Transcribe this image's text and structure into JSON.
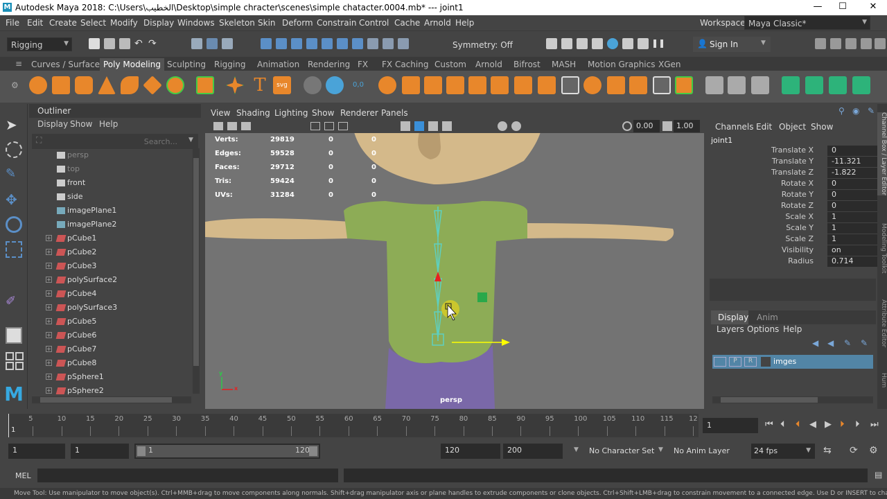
{
  "window": {
    "title": "Autodesk Maya 2018: C:\\Users\\الخطيب\\Desktop\\simple chracter\\scenes\\simple chatacter.0004.mb*  ---  joint1",
    "min": "—",
    "max": "☐",
    "close": "✕"
  },
  "menubar": [
    "File",
    "Edit",
    "Create",
    "Select",
    "Modify",
    "Display",
    "Windows",
    "Skeleton",
    "Skin",
    "Deform",
    "Constrain",
    "Control",
    "Cache",
    "Arnold",
    "Help"
  ],
  "workspace": {
    "label": "Workspace :",
    "value": "Maya Classic*"
  },
  "statusline": {
    "menuset": "Rigging",
    "symmetry": "Symmetry: Off",
    "signin": "Sign In"
  },
  "shelf_tabs": [
    "Curves / Surfaces",
    "Poly Modeling",
    "Sculpting",
    "Rigging",
    "Animation",
    "Rendering",
    "FX",
    "FX Caching",
    "Custom",
    "Arnold",
    "Bifrost",
    "MASH",
    "Motion Graphics",
    "XGen"
  ],
  "shelf_active": "Poly Modeling",
  "outliner": {
    "title": "Outliner",
    "menu": [
      "Display",
      "Show",
      "Help"
    ],
    "search_placeholder": "Search...",
    "items": [
      {
        "label": "persp",
        "type": "camera",
        "dim": true
      },
      {
        "label": "top",
        "type": "camera",
        "dim": true
      },
      {
        "label": "front",
        "type": "camera",
        "dim": false
      },
      {
        "label": "side",
        "type": "camera",
        "dim": false
      },
      {
        "label": "imagePlane1",
        "type": "imageplane",
        "dim": false
      },
      {
        "label": "imagePlane2",
        "type": "imageplane",
        "dim": false
      },
      {
        "label": "pCube1",
        "type": "mesh",
        "dim": false
      },
      {
        "label": "pCube2",
        "type": "mesh",
        "dim": false
      },
      {
        "label": "pCube3",
        "type": "mesh",
        "dim": false
      },
      {
        "label": "polySurface2",
        "type": "mesh",
        "dim": false
      },
      {
        "label": "pCube4",
        "type": "mesh",
        "dim": false
      },
      {
        "label": "polySurface3",
        "type": "mesh",
        "dim": false
      },
      {
        "label": "pCube5",
        "type": "mesh",
        "dim": false
      },
      {
        "label": "pCube6",
        "type": "mesh",
        "dim": false
      },
      {
        "label": "pCube7",
        "type": "mesh",
        "dim": false
      },
      {
        "label": "pCube8",
        "type": "mesh",
        "dim": false
      },
      {
        "label": "pSphere1",
        "type": "mesh",
        "dim": false
      },
      {
        "label": "pSphere2",
        "type": "mesh",
        "dim": false
      }
    ]
  },
  "viewport": {
    "menu": [
      "View",
      "Shading",
      "Lighting",
      "Show",
      "Renderer",
      "Panels"
    ],
    "field1": "0.00",
    "field2": "1.00",
    "camera": "persp",
    "hud": [
      {
        "label": "Verts:",
        "a": "29819",
        "b": "0",
        "c": "0"
      },
      {
        "label": "Edges:",
        "a": "59528",
        "b": "0",
        "c": "0"
      },
      {
        "label": "Faces:",
        "a": "29712",
        "b": "0",
        "c": "0"
      },
      {
        "label": "Tris:",
        "a": "59424",
        "b": "0",
        "c": "0"
      },
      {
        "label": "UVs:",
        "a": "31284",
        "b": "0",
        "c": "0"
      }
    ],
    "axis_x": "x",
    "axis_y": "y"
  },
  "channelbox": {
    "menu": [
      "Channels",
      "Edit",
      "Object",
      "Show"
    ],
    "object": "joint1",
    "attrs": [
      {
        "name": "Translate X",
        "value": "0"
      },
      {
        "name": "Translate Y",
        "value": "-11.321"
      },
      {
        "name": "Translate Z",
        "value": "-1.822"
      },
      {
        "name": "Rotate X",
        "value": "0"
      },
      {
        "name": "Rotate Y",
        "value": "0"
      },
      {
        "name": "Rotate Z",
        "value": "0"
      },
      {
        "name": "Scale X",
        "value": "1"
      },
      {
        "name": "Scale Y",
        "value": "1"
      },
      {
        "name": "Scale Z",
        "value": "1"
      },
      {
        "name": "Visibility",
        "value": "on"
      },
      {
        "name": "Radius",
        "value": "0.714"
      }
    ],
    "layer_tabs": [
      "Display",
      "Anim"
    ],
    "layer_menu": [
      "Layers",
      "Options",
      "Help"
    ],
    "layer": {
      "v": "V",
      "p": "P",
      "r": "R",
      "name": "imges"
    },
    "side_tabs": [
      "Channel Box / Layer Editor",
      "Modeling Toolkit",
      "Attribute Editor",
      "Hum"
    ]
  },
  "timeslider": {
    "ticks": [
      "5",
      "10",
      "15",
      "20",
      "25",
      "30",
      "35",
      "40",
      "45",
      "50",
      "55",
      "60",
      "65",
      "70",
      "75",
      "80",
      "85",
      "90",
      "95",
      "100",
      "105",
      "110",
      "115",
      "12"
    ],
    "start_tick": "1",
    "current_frame": "1"
  },
  "range": {
    "start": "1",
    "start2": "1",
    "slider_start": "1",
    "slider_end": "120",
    "end": "120",
    "end2": "200",
    "charset": "No Character Set",
    "animlayer": "No Anim Layer",
    "fps": "24 fps"
  },
  "cmdline": {
    "lang": "MEL"
  },
  "helpline": "Move Tool: Use manipulator to move object(s). Ctrl+MMB+drag to move components along normals. Shift+drag manipulator axis or plane handles to extrude components or clone objects. Ctrl+Shift+LMB+drag to constrain movement to a connected edge. Use D or INSERT to change the pivot pos"
}
